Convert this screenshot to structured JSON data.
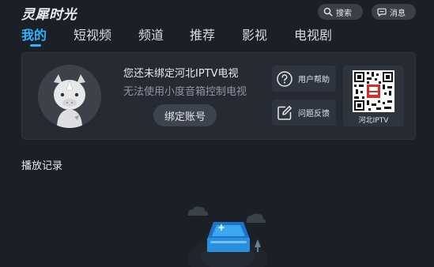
{
  "app": {
    "logo_text": "灵犀时光"
  },
  "header": {
    "search_label": "搜索",
    "message_label": "消息"
  },
  "tabs": [
    {
      "label": "我的",
      "active": true
    },
    {
      "label": "短视频",
      "active": false
    },
    {
      "label": "频道",
      "active": false
    },
    {
      "label": "推荐",
      "active": false
    },
    {
      "label": "影视",
      "active": false
    },
    {
      "label": "电视剧",
      "active": false
    }
  ],
  "account_card": {
    "title": "您还未绑定河北IPTV电视",
    "subtitle": "无法使用小度音箱控制电视",
    "bind_button": "绑定账号",
    "help_label": "用户帮助",
    "feedback_label": "问题反馈",
    "qr_caption": "河北IPTV"
  },
  "history": {
    "title": "播放记录"
  },
  "colors": {
    "background": "#1b1f26",
    "accent": "#2fb3ff",
    "card": "#262b33"
  }
}
